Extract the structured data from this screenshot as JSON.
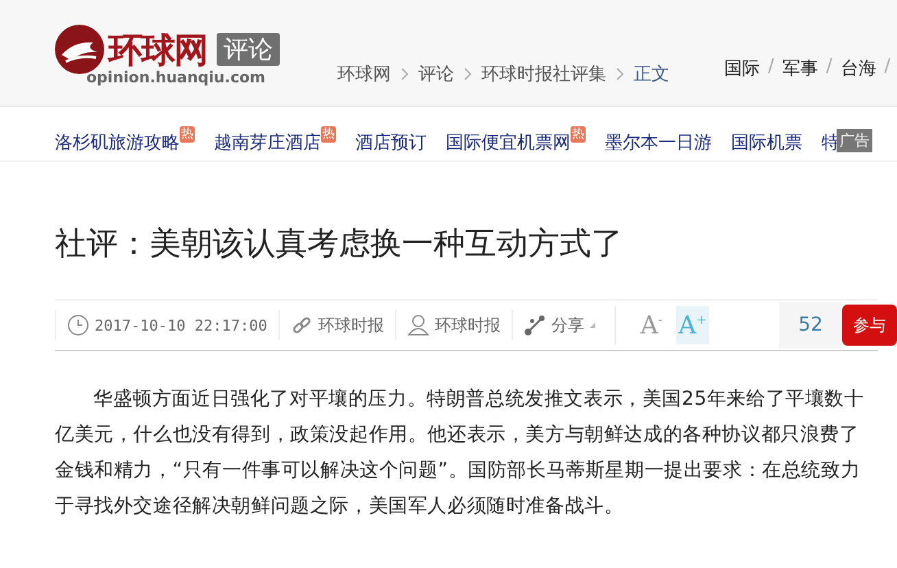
{
  "header": {
    "logo": {
      "name": "环球网",
      "section": "评论",
      "domain": "opinion.huanqiu.com"
    },
    "breadcrumb": [
      {
        "label": "环球网",
        "current": false
      },
      {
        "label": "评论",
        "current": false
      },
      {
        "label": "环球时报社评集",
        "current": false
      },
      {
        "label": "正文",
        "current": true
      }
    ],
    "top_nav": {
      "items": [
        "国际",
        "军事",
        "台海"
      ],
      "separator": "/"
    }
  },
  "ad_links": [
    {
      "label": "洛杉矶旅游攻略",
      "badge": "热"
    },
    {
      "label": "越南芽庄酒店",
      "badge": "热"
    },
    {
      "label": "酒店预订"
    },
    {
      "label": "国际便宜机票网",
      "badge": "热"
    },
    {
      "label": "墨尔本一日游"
    },
    {
      "label": "国际机票"
    },
    {
      "label": "特"
    }
  ],
  "ad_tag": "广告",
  "article": {
    "title": "社评：美朝该认真考虑换一种互动方式了",
    "meta": {
      "time": "2017-10-10 22:17:00",
      "source": "环球时报",
      "author": "环球时报",
      "share": "分享"
    },
    "font_controls": [
      {
        "label": "A",
        "sign": "-",
        "selected": false
      },
      {
        "label": "A",
        "sign": "+",
        "selected": true
      }
    ],
    "comment_count": "52",
    "join_button": "参与",
    "paragraph": "华盛顿方面近日强化了对平壤的压力。特朗普总统发推文表示，美国25年来给了平壤数十亿美元，什么也没有得到，政策没起作用。他还表示，美方与朝鲜达成的各种协议都只浪费了金钱和精力，“只有一件事可以解决这个问题”。国防部长马蒂斯星期一提出要求：在总统致力于寻找外交途径解决朝鲜问题之际，美国军人必须随时准备战斗。"
  }
}
